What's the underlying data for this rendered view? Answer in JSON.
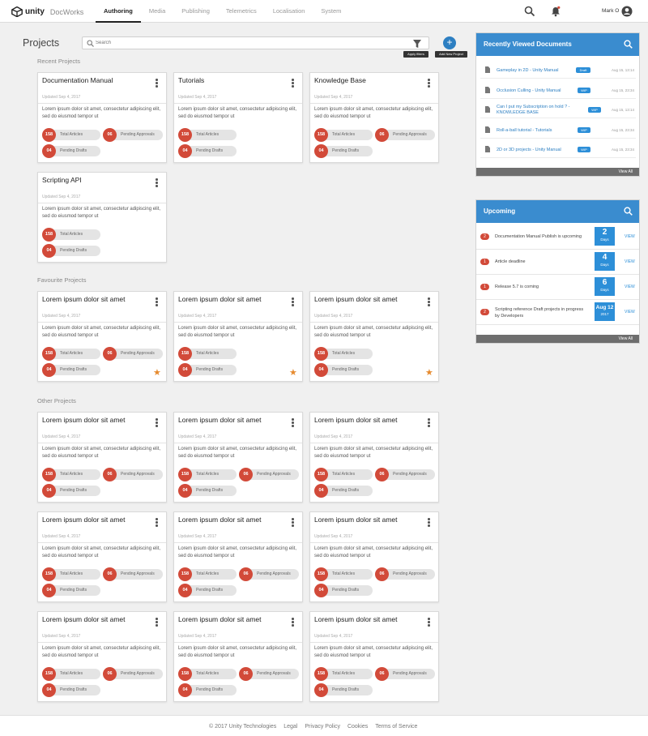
{
  "header": {
    "brand": "unity",
    "product": "DocWorks",
    "tabs": [
      "Authoring",
      "Media",
      "Publishing",
      "Telemetrics",
      "Localisation",
      "System"
    ],
    "active_tab": "Authoring",
    "user_name": "Mark O"
  },
  "toolbar": {
    "title": "Projects",
    "search_placeholder": "Search",
    "apply_filters_label": "Apply filters",
    "add_project_label": "Add New Project",
    "add_symbol": "+"
  },
  "sections": {
    "recent": "Recent Projects",
    "favourite": "Favourite Projects",
    "other": "Other  Projects"
  },
  "labels": {
    "total_articles": "Total Articles",
    "pending_approvals": "Pending Approvals",
    "pending_drafts": "Pending Drafts"
  },
  "recent_projects": [
    {
      "title": "Documentation Manual",
      "updated": "Updated Sep 4, 2017",
      "description": "Lorem ipsum dolor sit amet, consectetur adipiscing elit, sed do eiusmod tempor ut",
      "total": "158",
      "approvals": "06",
      "drafts": "04"
    },
    {
      "title": "Tutorials",
      "updated": "Updated Sep 4, 2017",
      "description": "Lorem ipsum dolor sit amet, consectetur adipiscing elit, sed do eiusmod tempor ut",
      "total": "158",
      "approvals": "",
      "drafts": "04"
    },
    {
      "title": "Knowledge Base",
      "updated": "Updated Sep 4, 2017",
      "description": "Lorem ipsum dolor sit amet, consectetur adipiscing elit, sed do eiusmod tempor ut",
      "total": "158",
      "approvals": "06",
      "drafts": "04"
    },
    {
      "title": "Scripting API",
      "updated": "Updated Sep 4, 2017",
      "description": "Lorem ipsum dolor sit amet, consectetur adipiscing elit, sed do eiusmod tempor ut",
      "total": "158",
      "approvals": "",
      "drafts": "04"
    }
  ],
  "favourite_projects": [
    {
      "title": "Lorem ipsum dolor sit amet",
      "updated": "Updated Sep 4, 2017",
      "description": "Lorem ipsum dolor sit amet, consectetur adipiscing elit, sed do eiusmod tempor ut",
      "total": "158",
      "approvals": "06",
      "drafts": "04"
    },
    {
      "title": "Lorem ipsum dolor sit amet",
      "updated": "Updated Sep 4, 2017",
      "description": "Lorem ipsum dolor sit amet, consectetur adipiscing elit, sed do eiusmod tempor ut",
      "total": "158",
      "approvals": "",
      "drafts": "04"
    },
    {
      "title": "Lorem ipsum dolor sit amet",
      "updated": "Updated Sep 4, 2017",
      "description": "Lorem ipsum dolor sit amet, consectetur adipiscing elit, sed do eiusmod tempor ut",
      "total": "158",
      "approvals": "",
      "drafts": "04"
    }
  ],
  "other_projects": [
    {
      "title": "Lorem ipsum dolor sit amet",
      "updated": "Updated Sep 4, 2017",
      "description": "Lorem ipsum dolor sit amet, consectetur adipiscing elit, sed do eiusmod tempor ut",
      "total": "158",
      "approvals": "06",
      "drafts": "04"
    },
    {
      "title": "Lorem ipsum dolor sit amet",
      "updated": "Updated Sep 4, 2017",
      "description": "Lorem ipsum dolor sit amet, consectetur adipiscing elit, sed do eiusmod tempor ut",
      "total": "158",
      "approvals": "06",
      "drafts": "04"
    },
    {
      "title": "Lorem ipsum dolor sit amet",
      "updated": "Updated Sep 4, 2017",
      "description": "Lorem ipsum dolor sit amet, consectetur adipiscing elit, sed do eiusmod tempor ut",
      "total": "158",
      "approvals": "06",
      "drafts": "04"
    },
    {
      "title": "Lorem ipsum dolor sit amet",
      "updated": "Updated Sep 4, 2017",
      "description": "Lorem ipsum dolor sit amet, consectetur adipiscing elit, sed do eiusmod tempor ut",
      "total": "158",
      "approvals": "06",
      "drafts": "04"
    },
    {
      "title": "Lorem ipsum dolor sit amet",
      "updated": "Updated Sep 4, 2017",
      "description": "Lorem ipsum dolor sit amet, consectetur adipiscing elit, sed do eiusmod tempor ut",
      "total": "158",
      "approvals": "06",
      "drafts": "04"
    },
    {
      "title": "Lorem ipsum dolor sit amet",
      "updated": "Updated Sep 4, 2017",
      "description": "Lorem ipsum dolor sit amet, consectetur adipiscing elit, sed do eiusmod tempor ut",
      "total": "158",
      "approvals": "06",
      "drafts": "04"
    },
    {
      "title": "Lorem ipsum dolor sit amet",
      "updated": "Updated Sep 4, 2017",
      "description": "Lorem ipsum dolor sit amet, consectetur adipiscing elit, sed do eiusmod tempor ut",
      "total": "158",
      "approvals": "06",
      "drafts": "04"
    },
    {
      "title": "Lorem ipsum dolor sit amet",
      "updated": "Updated Sep 4, 2017",
      "description": "Lorem ipsum dolor sit amet, consectetur adipiscing elit, sed do eiusmod tempor ut",
      "total": "158",
      "approvals": "06",
      "drafts": "04"
    },
    {
      "title": "Lorem ipsum dolor sit amet",
      "updated": "Updated Sep 4, 2017",
      "description": "Lorem ipsum dolor sit amet, consectetur adipiscing elit, sed do eiusmod tempor ut",
      "total": "158",
      "approvals": "06",
      "drafts": "04"
    }
  ],
  "recently_viewed": {
    "title": "Recently Viewed Documents",
    "view_all": "View All",
    "items": [
      {
        "name": "Gameplay in 2D - Unity Manual",
        "tag": "Draft",
        "date": "Aug 15, 13:14"
      },
      {
        "name": "Occlusion Culling - Unity Manual",
        "tag": "WIP",
        "date": "Aug 15, 23:34"
      },
      {
        "name": "Can I put my Subscription on hold ? - KNOWLEDGE BASE",
        "tag": "WIP",
        "date": "Aug 15, 13:14"
      },
      {
        "name": "Roll-a-ball tutorial - Tutorials",
        "tag": "WIP",
        "date": "Aug 15, 23:34"
      },
      {
        "name": "2D or 3D projects - Unity Manual",
        "tag": "WIP",
        "date": "Aug 15, 23:34"
      }
    ]
  },
  "upcoming": {
    "title": "Upcoming",
    "view_all": "View All",
    "items": [
      {
        "count": "2",
        "text": "Documentation Manual Publish is upcoming",
        "date_num": "2",
        "date_unit": "Days",
        "view": "VIEW"
      },
      {
        "count": "1",
        "text": "Article deadline",
        "date_num": "4",
        "date_unit": "Days",
        "view": "VIEW"
      },
      {
        "count": "1",
        "text": "Release 5.7 is coming",
        "date_num": "6",
        "date_unit": "Days",
        "view": "VIEW"
      },
      {
        "count": "2",
        "text": "Scripting reference Draft projects in progress by Developers",
        "date_num": "Aug 12",
        "date_unit": "2017",
        "view": "VIEW"
      }
    ]
  },
  "footer": {
    "links": [
      "© 2017 Unity Technologies",
      "Legal",
      "Privacy Policy",
      "Cookies",
      "Terms of Service"
    ]
  },
  "colors": {
    "accent": "#3a8ccf",
    "badge": "#d24a39",
    "star": "#e68a2e"
  }
}
